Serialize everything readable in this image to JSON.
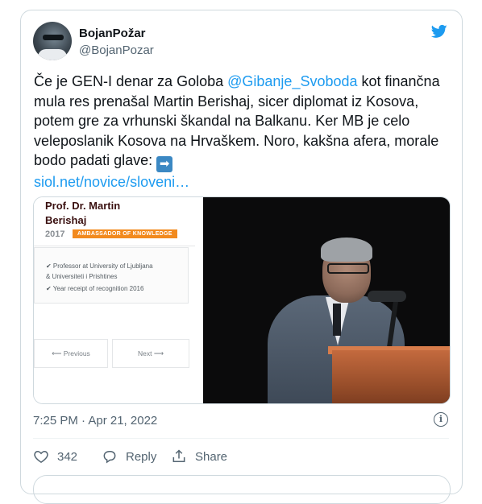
{
  "author": {
    "display_name": "BojanPožar",
    "handle": "@BojanPozar"
  },
  "tweet": {
    "text_before_mention": "Če je GEN-I denar za Goloba ",
    "mention": "@Gibanje_Svoboda",
    "text_after_mention": " kot finančna mula res prenašal Martin Berishaj, sicer diplomat iz Kosova, potem gre za vrhunski škandal na Balkanu. Ker MB je celo veleposlanik Kosova na Hrvaškem. Noro, kakšna afera, morale bodo padati glave: ",
    "arrow_emoji": "➡",
    "link": "siol.net/novice/sloveni…"
  },
  "media": {
    "left_panel": {
      "title_line1": "Prof. Dr. Martin",
      "title_line2": "Berishaj",
      "year": "2017",
      "badge": "AMBASSADOR OF KNOWLEDGE",
      "info_line1": "✔ Professor at University of Ljubljana",
      "info_line2": "& Universiteti i Prishtines",
      "info_line3": "✔ Year receipt of recognition 2016",
      "prev_label": "⟵   Previous",
      "next_label": "Next  ⟶"
    }
  },
  "timestamp": "7:25 PM · Apr 21, 2022",
  "actions": {
    "like_count": "342",
    "reply_label": "Reply",
    "share_label": "Share"
  },
  "colors": {
    "accent": "#1d9bf0",
    "muted": "#536471",
    "like_red": "#f91880"
  }
}
